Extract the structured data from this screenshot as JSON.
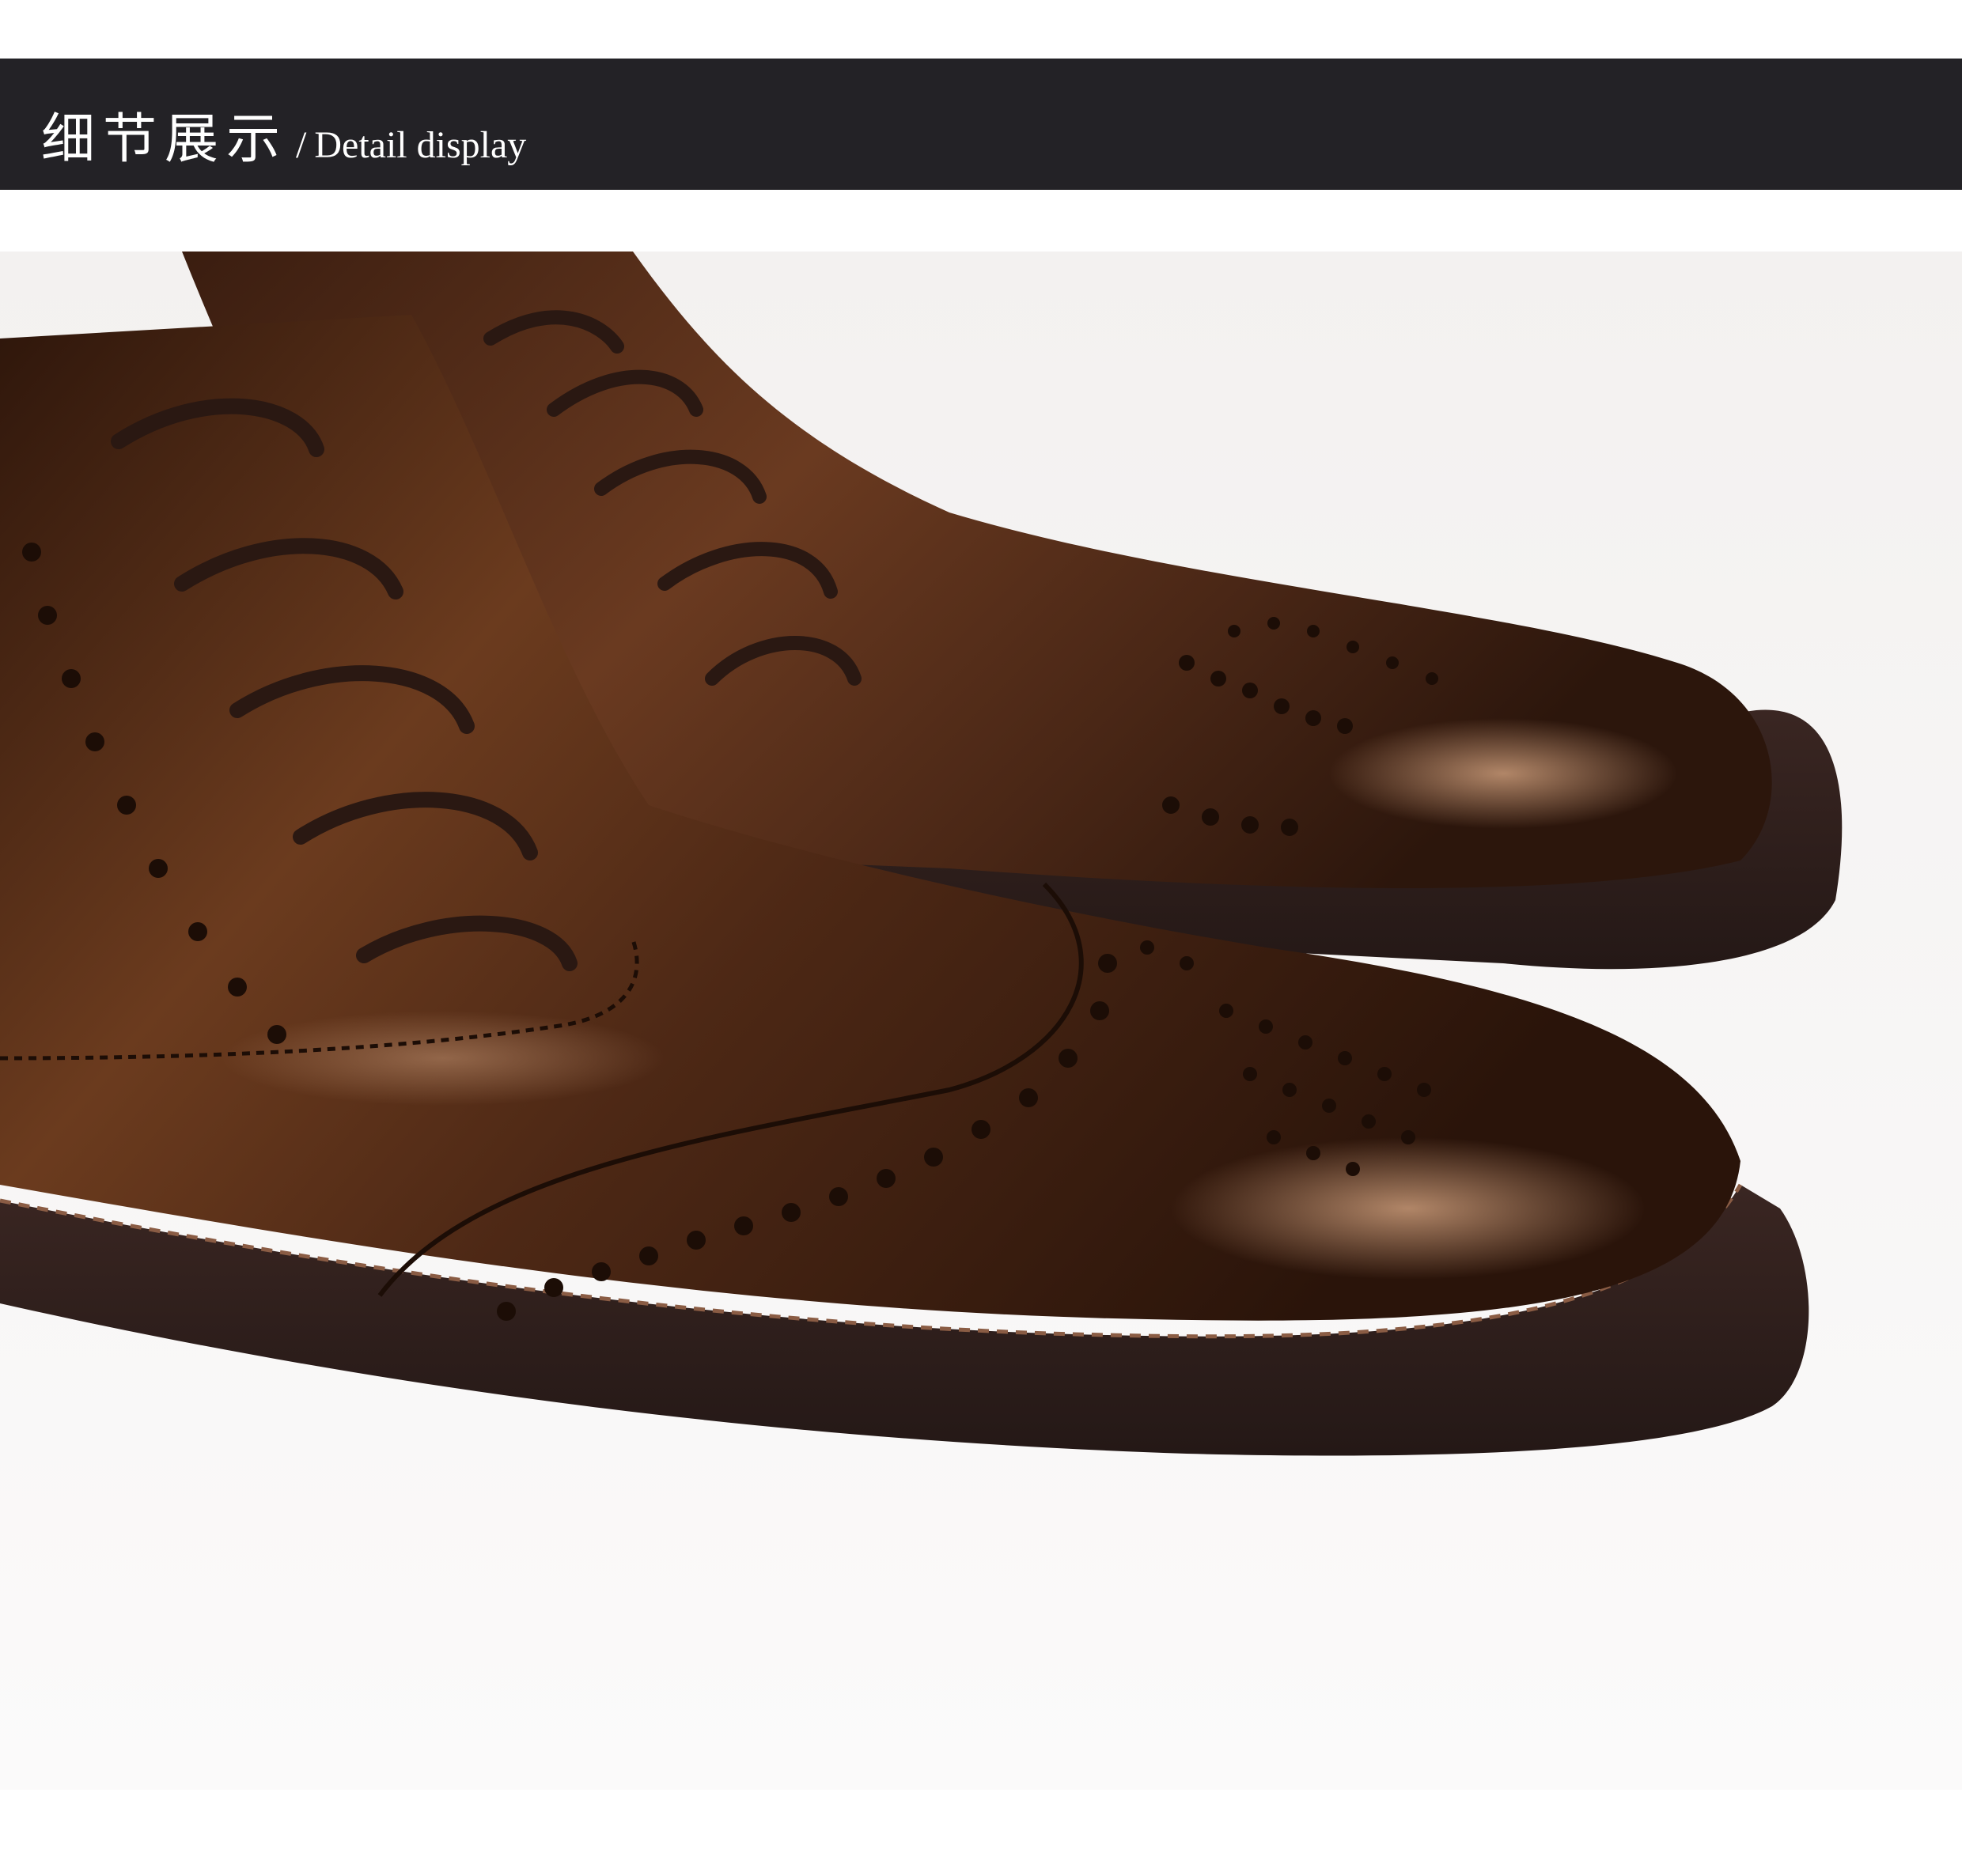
{
  "header": {
    "title_cn": "细节展示",
    "separator": "/",
    "title_en": "Detail display",
    "bar_color": "#232226",
    "text_color": "#ffffff"
  },
  "photo": {
    "subject": "brown-leather-brogue-boots-closeup",
    "leather_color": "#4a2614",
    "sole_color": "#2e1f1c",
    "background_color": "#f6f4f3"
  }
}
